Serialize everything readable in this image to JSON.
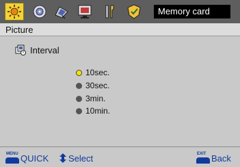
{
  "toolbar": {
    "icons": [
      "picture-settings-icon",
      "sound-disc-icon",
      "channel-satellite-icon",
      "display-monitor-icon",
      "tools-icon",
      "setup-shield-icon"
    ],
    "active_icon": "picture-settings-icon",
    "source_label": "Memory card",
    "active_color": "#f1d23a"
  },
  "section": {
    "title": "Picture"
  },
  "setting": {
    "label": "Interval",
    "icon": "slideshow-interval-icon"
  },
  "options": [
    {
      "label": "10sec.",
      "selected": true
    },
    {
      "label": "30sec.",
      "selected": false
    },
    {
      "label": "3min.",
      "selected": false
    },
    {
      "label": "10min.",
      "selected": false
    }
  ],
  "footer": {
    "quick_key": "MENU",
    "quick_label": "QUICK",
    "select_label": "Select",
    "back_key": "EXIT",
    "back_label": "Back",
    "hint_color": "#113a9c"
  }
}
